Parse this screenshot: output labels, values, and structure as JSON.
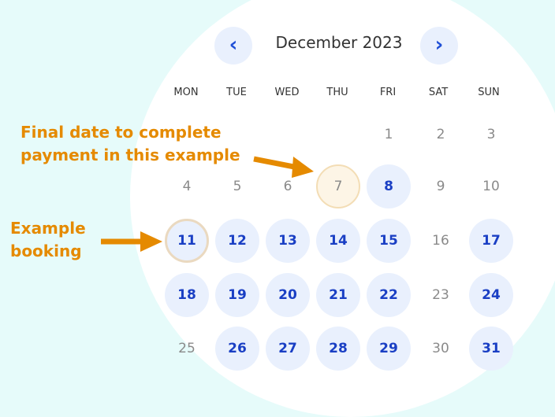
{
  "calendar": {
    "month_label": "December 2023",
    "prev_icon": "chevron-left-icon",
    "next_icon": "chevron-right-icon",
    "prev_glyph": "‹",
    "next_glyph": "›",
    "weekdays": [
      "MON",
      "TUE",
      "WED",
      "THU",
      "FRI",
      "SAT",
      "SUN"
    ],
    "days": {
      "d1": "1",
      "d2": "2",
      "d3": "3",
      "d4": "4",
      "d5": "5",
      "d6": "6",
      "d7": "7",
      "d8": "8",
      "d9": "9",
      "d10": "10",
      "d11": "11",
      "d12": "12",
      "d13": "13",
      "d14": "14",
      "d15": "15",
      "d16": "16",
      "d17": "17",
      "d18": "18",
      "d19": "19",
      "d20": "20",
      "d21": "21",
      "d22": "22",
      "d23": "23",
      "d24": "24",
      "d25": "25",
      "d26": "26",
      "d27": "27",
      "d28": "28",
      "d29": "29",
      "d30": "30",
      "d31": "31"
    }
  },
  "annotations": {
    "final_date_line1": "Final date to complete",
    "final_date_line2": "payment in this example",
    "booking_line1": "Example",
    "booking_line2": "booking"
  },
  "colors": {
    "accent": "#1a3fc4",
    "available_bg": "#e9f0fd",
    "annotation": "#e58a00",
    "background": "#e6fbfa"
  }
}
